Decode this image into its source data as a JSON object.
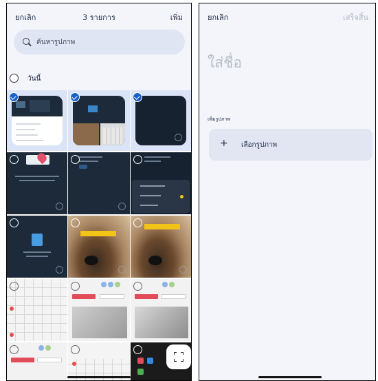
{
  "left": {
    "header": {
      "cancel": "ยกเลิก",
      "count": "3 รายการ",
      "add": "เพิ่ม"
    },
    "search": {
      "placeholder": "ค้นหารูปภาพ"
    },
    "section": {
      "label": "วันนี้"
    },
    "grid": {
      "selected_count": 3
    }
  },
  "right": {
    "header": {
      "cancel": "ยกเลิก",
      "done": "เสร็จสิ้น"
    },
    "title_placeholder": "ใส่ชื่อ",
    "section_label": "เพิ่มรูปภาพ",
    "choose_button": "เลือกรูปภาพ"
  },
  "colors": {
    "accent": "#1a61c9",
    "background": "#f3f5fa",
    "tile": "#e1e6f2"
  }
}
